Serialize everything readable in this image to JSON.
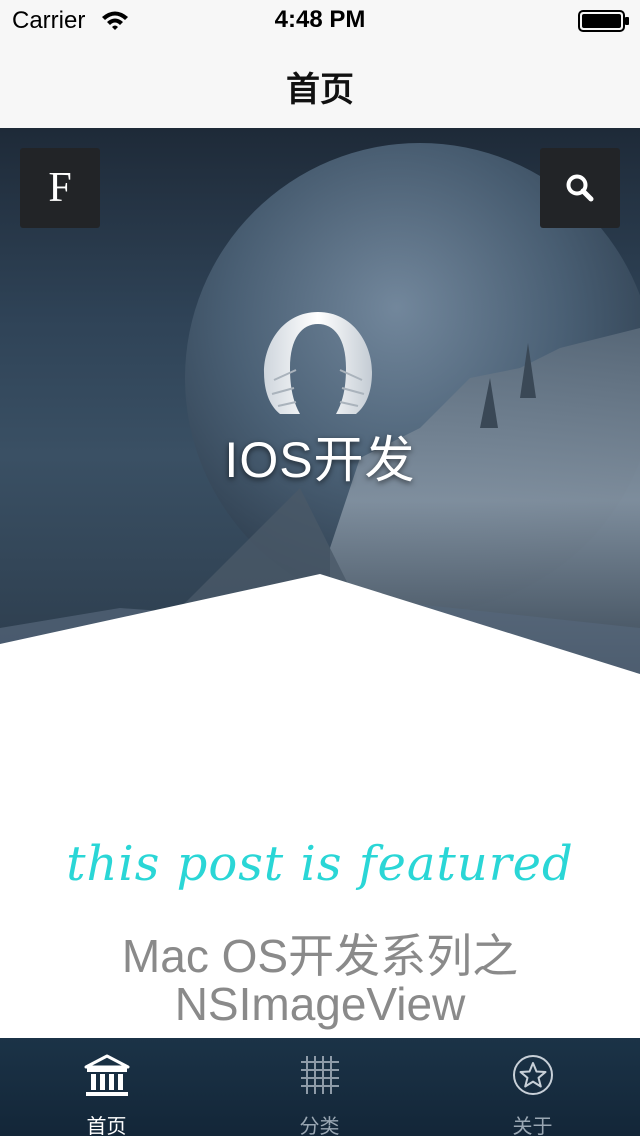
{
  "status_bar": {
    "carrier": "Carrier",
    "time": "4:48 PM",
    "wifi_icon": "wifi-icon",
    "battery_icon": "battery-icon"
  },
  "nav": {
    "title": "首页"
  },
  "hero": {
    "menu_button_label": "F",
    "search_icon": "search-icon",
    "logo_icon": "arch-logo-icon",
    "title": "IOS开发"
  },
  "featured": {
    "tag": "this post is featured",
    "post_title_line1": "Mac OS开发系列之",
    "post_title_line2": "NSImageView"
  },
  "tab_bar": {
    "tabs": [
      {
        "label": "首页",
        "icon": "bank-icon",
        "selected": true
      },
      {
        "label": "分类",
        "icon": "grid-icon",
        "selected": false
      },
      {
        "label": "关于",
        "icon": "star-badge-icon",
        "selected": false
      }
    ]
  },
  "colors": {
    "accent_teal": "#2ad6d6",
    "tab_bar_bg": "#1b3347",
    "hero_button_bg": "#222427"
  }
}
